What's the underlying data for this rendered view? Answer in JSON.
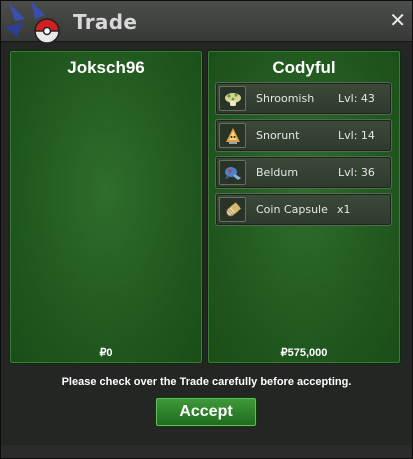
{
  "window": {
    "title": "Trade",
    "close_symbol": "✕"
  },
  "left_panel": {
    "player": "Joksch96",
    "money": "₽0",
    "items": []
  },
  "right_panel": {
    "player": "Codyful",
    "money": "₽575,000",
    "items": [
      {
        "icon": "shroomish-icon",
        "name": "Shroomish",
        "level": "Lvl: 43"
      },
      {
        "icon": "snorunt-icon",
        "name": "Snorunt",
        "level": "Lvl: 14"
      },
      {
        "icon": "beldum-icon",
        "name": "Beldum",
        "level": "Lvl: 36"
      },
      {
        "icon": "coin-capsule-icon",
        "name": "Coin Capsule",
        "quantity": "x1"
      }
    ]
  },
  "notice": "Please check over the Trade carefully before accepting.",
  "accept_label": "Accept",
  "colors": {
    "panel_green": "#256024",
    "accept_green": "#2f8a2b",
    "window_bg": "#232623"
  }
}
